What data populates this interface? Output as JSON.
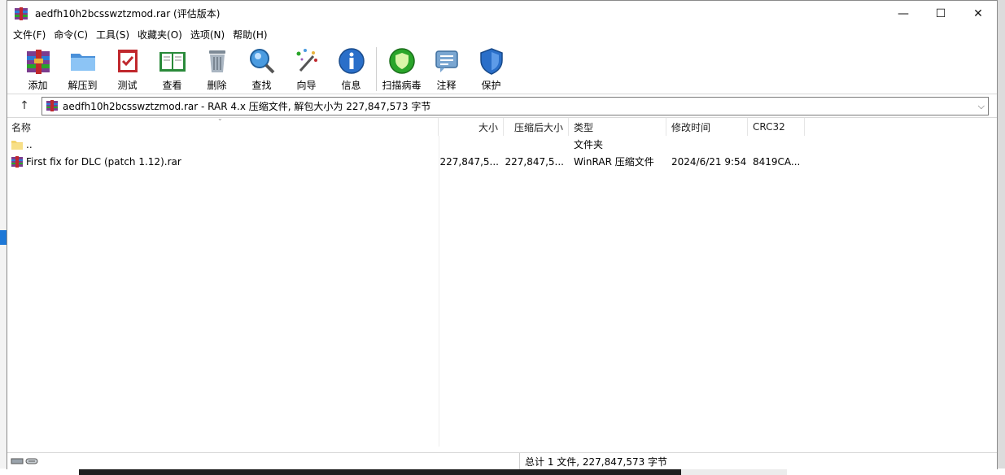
{
  "window": {
    "title": "aedfh10h2bcsswztzmod.rar (评估版本)",
    "controls": {
      "minimize": "—",
      "maximize": "☐",
      "close": "✕"
    }
  },
  "menu": [
    "文件(F)",
    "命令(C)",
    "工具(S)",
    "收藏夹(O)",
    "选项(N)",
    "帮助(H)"
  ],
  "toolbar": {
    "add": "添加",
    "extract": "解压到",
    "test": "测试",
    "view": "查看",
    "delete": "删除",
    "find": "查找",
    "wizard": "向导",
    "info": "信息",
    "virus_scan": "扫描病毒",
    "comment": "注释",
    "protect": "保护"
  },
  "address": {
    "up_icon": "↑",
    "path": "aedfh10h2bcsswztzmod.rar - RAR 4.x 压缩文件, 解包大小为 227,847,573 字节",
    "dropdown_icon": "chevron-down-icon"
  },
  "columns": {
    "name": "名称",
    "size": "大小",
    "packed": "压缩后大小",
    "type": "类型",
    "modified": "修改时间",
    "crc": "CRC32"
  },
  "rows": [
    {
      "name": "..",
      "size": "",
      "packed": "",
      "type": "文件夹",
      "modified": "",
      "crc": ""
    },
    {
      "name": "First fix for DLC (patch 1.12).rar",
      "size": "227,847,5...",
      "packed": "227,847,5...",
      "type": "WinRAR 压缩文件",
      "modified": "2024/6/21 9:54",
      "crc": "8419CA..."
    }
  ],
  "status": {
    "summary": "总计 1 文件, 227,847,573 字节"
  },
  "colors": {
    "accent_blue": "#1e78d7",
    "green_shield": "#2aa52a",
    "winrar_red": "#c0282d"
  }
}
